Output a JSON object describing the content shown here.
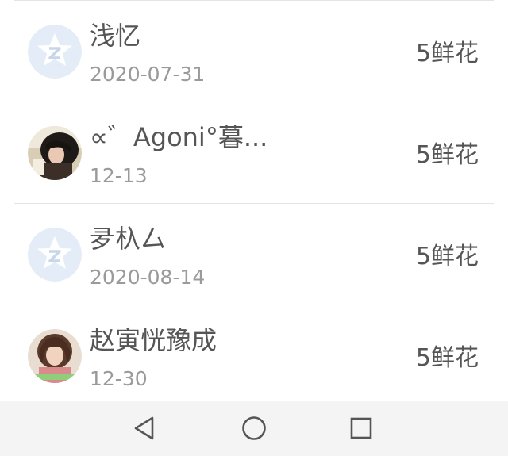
{
  "list": {
    "items": [
      {
        "name": "浅忆",
        "date": "2020-07-31",
        "gift": "5鲜花",
        "avatar": "default-qq-icon"
      },
      {
        "name": "∝゛Agoni°暮...",
        "date": "12-13",
        "gift": "5鲜花",
        "avatar": "user-photo"
      },
      {
        "name": "夛杁厶",
        "date": "2020-08-14",
        "gift": "5鲜花",
        "avatar": "default-qq-icon"
      },
      {
        "name": "赵寅恍豫成",
        "date": "12-30",
        "gift": "5鲜花",
        "avatar": "user-photo"
      }
    ]
  },
  "navbar": {
    "back": "back-icon",
    "home": "home-icon",
    "recents": "recents-icon"
  },
  "colors": {
    "divider": "#e4e4e4",
    "name_text": "#555555",
    "date_text": "#9a9a9a",
    "navbar_bg": "#f4f4f4",
    "default_avatar_bg": "#e3ecf7"
  }
}
